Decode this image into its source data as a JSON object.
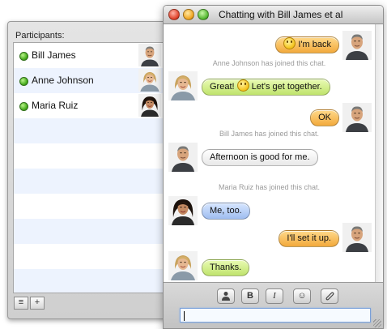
{
  "drawer": {
    "title": "Participants:",
    "participants": [
      {
        "name": "Bill James",
        "status": "available"
      },
      {
        "name": "Anne Johnson",
        "status": "available"
      },
      {
        "name": "Maria Ruiz",
        "status": "available"
      }
    ],
    "buttons": [
      "list-icon",
      "plus-icon"
    ],
    "plus_label": "+"
  },
  "window": {
    "title": "Chatting with Bill James et al"
  },
  "transcript": [
    {
      "type": "message",
      "from": "me",
      "text": "I'm back",
      "smiley": "before",
      "color": "#f2a93c"
    },
    {
      "type": "status",
      "text": "Anne Johnson has joined this chat."
    },
    {
      "type": "message",
      "from": "Anne Johnson",
      "text_before": "Great!",
      "text_after": "Let's get together.",
      "smiley": "middle",
      "color": "#bfe36c"
    },
    {
      "type": "message",
      "from": "me",
      "text": "OK",
      "color": "#f2a93c"
    },
    {
      "type": "status",
      "text": "Bill James has joined this chat."
    },
    {
      "type": "message",
      "from": "Bill James",
      "text": "Afternoon is good for me.",
      "color": "#ffffff"
    },
    {
      "type": "status",
      "text": "Maria Ruiz has joined this chat."
    },
    {
      "type": "message",
      "from": "Maria Ruiz",
      "text": "Me, too.",
      "color": "#9fbdf0"
    },
    {
      "type": "message",
      "from": "me",
      "text": "I'll set it up.",
      "color": "#f2a93c"
    },
    {
      "type": "message",
      "from": "Anne Johnson",
      "text": "Thanks.",
      "color": "#bfe36c"
    }
  ],
  "toolbar": {
    "buttons": [
      {
        "name": "person-icon",
        "glyph": "👤"
      },
      {
        "name": "bold-icon",
        "glyph": "B"
      },
      {
        "name": "italic-icon",
        "glyph": "I"
      },
      {
        "name": "smiley-icon",
        "glyph": "☺"
      },
      {
        "name": "paperclip-icon",
        "glyph": "📎"
      }
    ]
  },
  "input": {
    "value": ""
  }
}
